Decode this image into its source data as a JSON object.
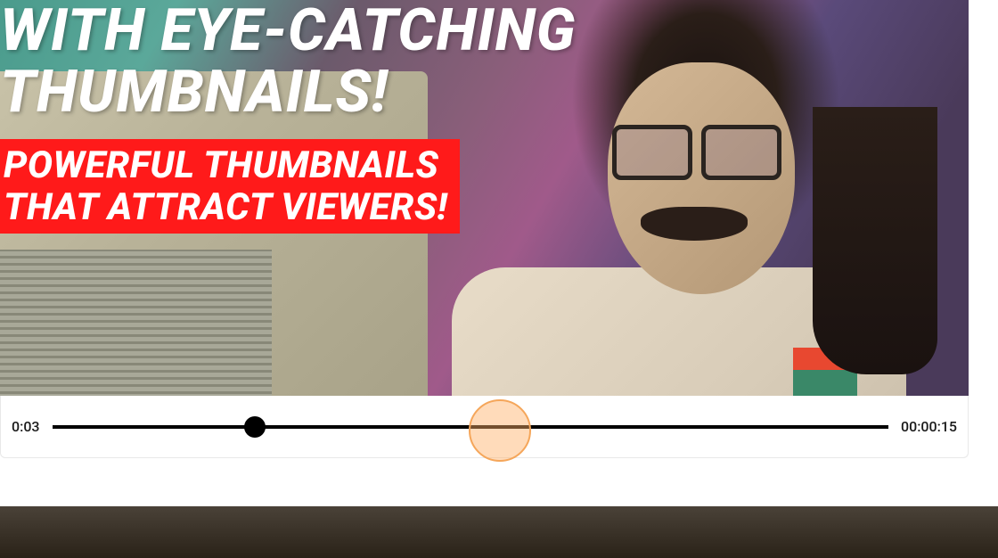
{
  "video": {
    "overlay_headline": "WITH EYE-CATCHING\nTHUMBNAILS!",
    "overlay_subhead": "POWERFUL THUMBNAILS\nTHAT ATTRACT VIEWERS!"
  },
  "timeline": {
    "current_time": "0:03",
    "total_time": "00:00:15",
    "playhead_percent": 24.2
  },
  "colors": {
    "overlay_bg": "#ff1a1a",
    "highlight": "#f5a65a"
  }
}
